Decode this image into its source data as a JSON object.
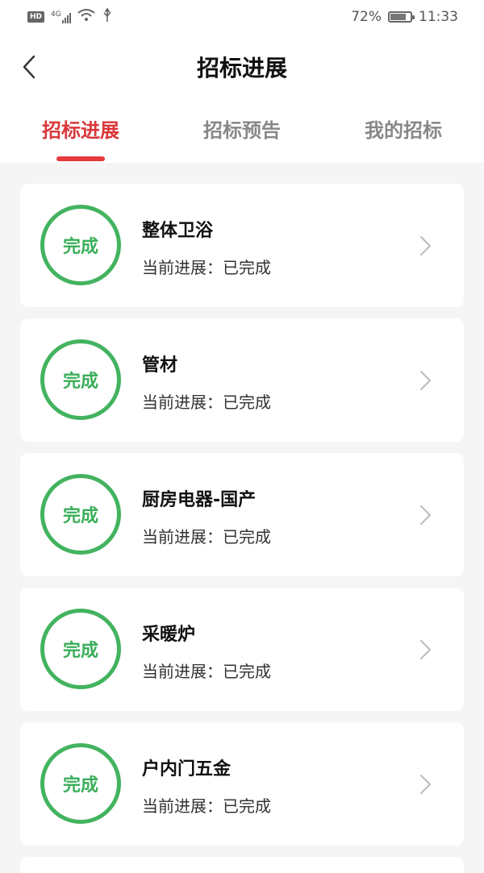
{
  "status_bar": {
    "hd_label": "HD",
    "network": "4G",
    "battery_text": "72%",
    "battery_level": 0.72,
    "time": "11:33"
  },
  "header": {
    "title": "招标进展"
  },
  "tabs": [
    {
      "label": "招标进展",
      "active": true
    },
    {
      "label": "招标预告",
      "active": false
    },
    {
      "label": "我的招标",
      "active": false
    }
  ],
  "items": [
    {
      "badge": "完成",
      "title": "整体卫浴",
      "status": "当前进展：已完成"
    },
    {
      "badge": "完成",
      "title": "管材",
      "status": "当前进展：已完成"
    },
    {
      "badge": "完成",
      "title": "厨房电器-国产",
      "status": "当前进展：已完成"
    },
    {
      "badge": "完成",
      "title": "采暖炉",
      "status": "当前进展：已完成"
    },
    {
      "badge": "完成",
      "title": "户内门五金",
      "status": "当前进展：已完成"
    }
  ],
  "colors": {
    "accent_red": "#e63a3e",
    "complete_green": "#43b35f",
    "background": "#f5f5f5"
  }
}
